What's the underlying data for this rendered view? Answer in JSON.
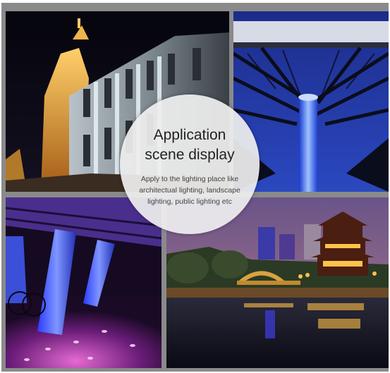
{
  "overlay": {
    "title_lines": [
      "Application",
      "scene display"
    ],
    "description_lines": [
      "Apply to the lighting place like",
      "architectual lighting, landscape",
      "lighting, public lighting etc"
    ]
  },
  "photos": [
    {
      "name": "illuminated-historic-building-photo"
    },
    {
      "name": "stadium-roof-blue-light-column-photo"
    },
    {
      "name": "purple-lit-bridge-pillars-photo"
    },
    {
      "name": "night-pavilion-waterfront-photo"
    }
  ],
  "colors": {
    "frame": "#8a8a8a",
    "circle": "#eeeeee",
    "title_text": "#222222",
    "desc_text": "#444444"
  }
}
